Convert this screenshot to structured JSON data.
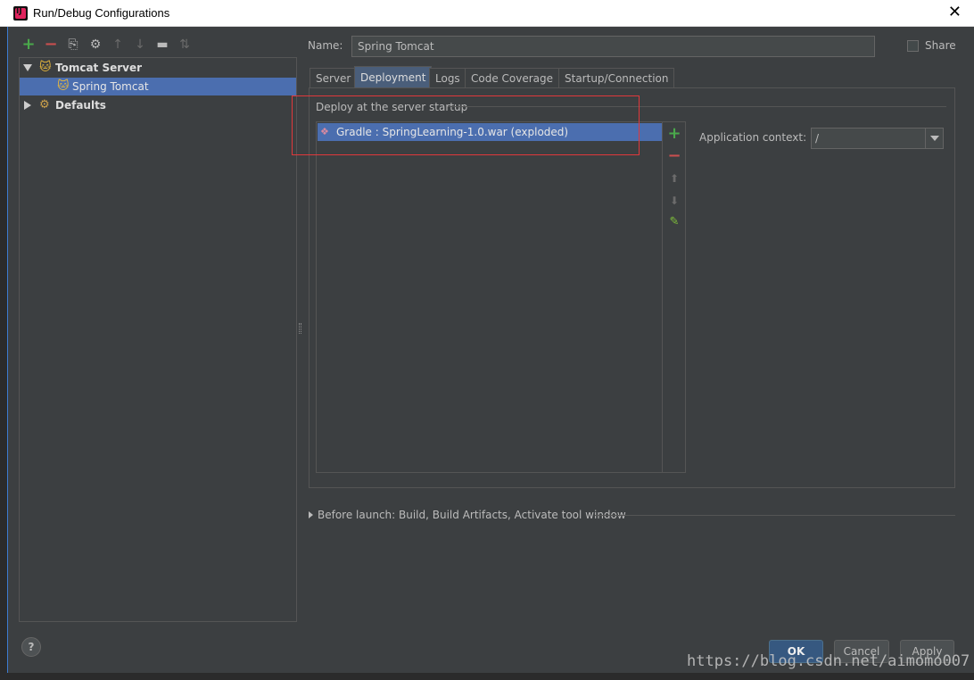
{
  "window": {
    "title": "Run/Debug Configurations",
    "close_glyph": "✕"
  },
  "toolbar": {
    "add_glyph": "+",
    "remove_glyph": "−",
    "copy_glyph": "⎘",
    "edit_defaults_glyph": "⚙",
    "move_up_glyph": "↑",
    "move_down_glyph": "↓",
    "folder_glyph": "▬",
    "sort_glyph": "⇅"
  },
  "tree": {
    "items": [
      {
        "label": "Tomcat Server",
        "expanded": true,
        "bold": true
      },
      {
        "label": "Spring Tomcat",
        "selected": true
      },
      {
        "label": "Defaults",
        "expanded": false,
        "bold": true
      }
    ]
  },
  "name_field": {
    "label": "Name:",
    "value": "Spring Tomcat"
  },
  "share": {
    "label": "Share",
    "checked": false
  },
  "tabs": [
    {
      "label": "Server"
    },
    {
      "label": "Deployment",
      "active": true
    },
    {
      "label": "Logs"
    },
    {
      "label": "Code Coverage"
    },
    {
      "label": "Startup/Connection"
    }
  ],
  "deployment": {
    "section_label": "Deploy at the server startup",
    "artifacts": [
      {
        "label": "Gradle : SpringLearning-1.0.war (exploded)",
        "selected": true
      }
    ],
    "side_buttons": {
      "add": "+",
      "remove": "−",
      "up": "⬆",
      "down": "⬇",
      "edit": "✎"
    },
    "app_context_label": "Application context:",
    "app_context_value": "/"
  },
  "before_launch": {
    "label": "Before launch: Build, Build Artifacts, Activate tool window"
  },
  "buttons": {
    "help": "?",
    "ok": "OK",
    "cancel": "Cancel",
    "apply": "Apply"
  },
  "watermark": "https://blog.csdn.net/aimomo007",
  "colors": {
    "selection": "#4b6eaf",
    "add_green": "#4aa94b",
    "remove_red": "#c94f4f",
    "highlight_box": "#e0383b"
  }
}
